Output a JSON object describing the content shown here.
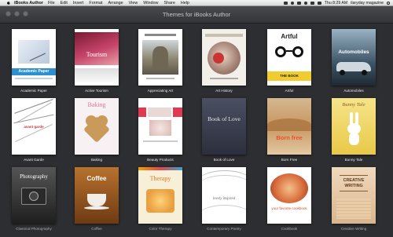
{
  "menubar": {
    "app_name": "iBooks Author",
    "items": [
      "File",
      "Edit",
      "Insert",
      "Format",
      "Arrange",
      "View",
      "Window",
      "Share",
      "Help"
    ],
    "clock": "Thu 8:29 AM",
    "user": "ilaryday magazine"
  },
  "window": {
    "title": "Themes for iBooks Author"
  },
  "themes": [
    {
      "label": "Academic Paper",
      "cover_text": "Academic Paper"
    },
    {
      "label": "Active Tourism",
      "cover_text": "Tourism"
    },
    {
      "label": "Appreciating Art",
      "cover_text": ""
    },
    {
      "label": "Art History",
      "cover_text": ""
    },
    {
      "label": "Artful",
      "cover_text": "Artful",
      "cover_subtext": "THE BOOK"
    },
    {
      "label": "Automobiles",
      "cover_text": "Automobiles"
    },
    {
      "label": "Avant Garde",
      "cover_text": "avant garde"
    },
    {
      "label": "Baking",
      "cover_text": "Baking"
    },
    {
      "label": "Beauty Products",
      "cover_text": ""
    },
    {
      "label": "Book of Love",
      "cover_text": "Book of Love"
    },
    {
      "label": "Born Free",
      "cover_text": "Born free"
    },
    {
      "label": "Bunny Tale",
      "cover_text": "Bunny Tale"
    },
    {
      "label": "Classical Photography",
      "cover_text": "Photography"
    },
    {
      "label": "Coffee",
      "cover_text": "Coffee"
    },
    {
      "label": "Color Therapy",
      "cover_text": "Therapy"
    },
    {
      "label": "Contemporary Poetry",
      "cover_text": "lovely inspired"
    },
    {
      "label": "Cookbook",
      "cover_text": "your favorite cookbook"
    },
    {
      "label": "Creative Writing",
      "cover_text": "CREATIVE WRITING"
    }
  ]
}
